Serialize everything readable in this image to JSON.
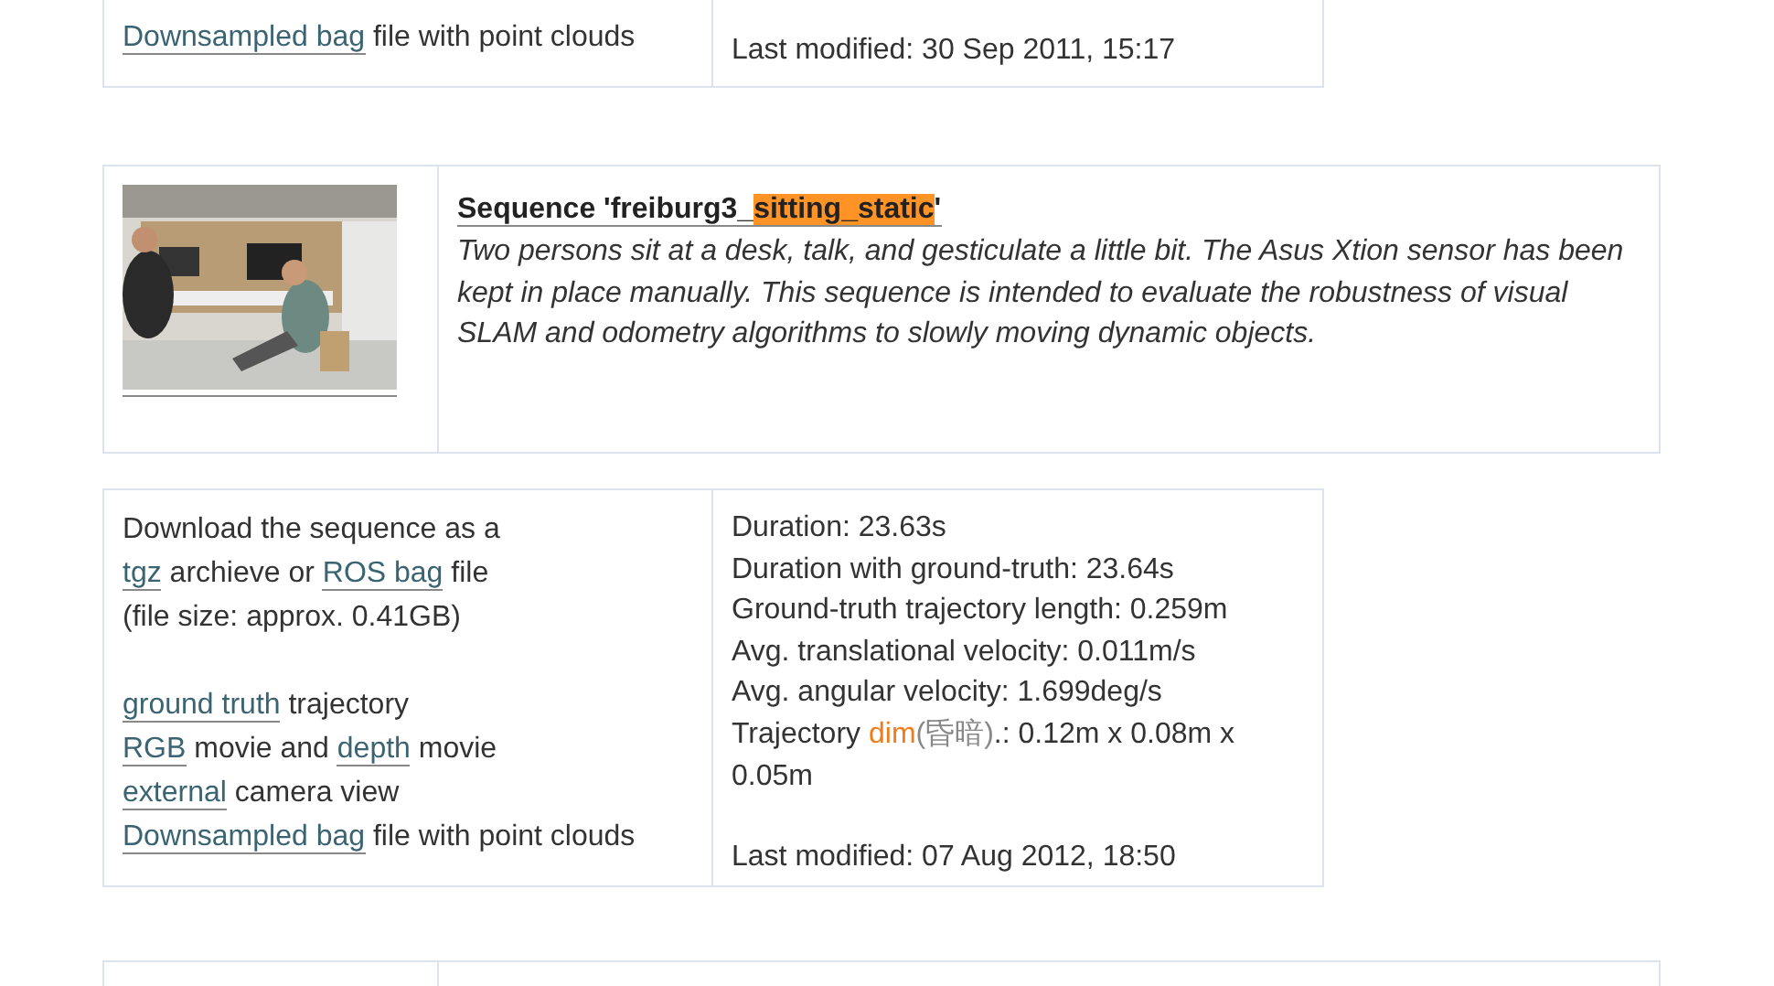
{
  "previous_entry": {
    "files": [
      [
        {
          "kind": "link",
          "text": "Downsampled bag"
        },
        {
          "kind": "text",
          "text": " file with point clouds"
        }
      ]
    ],
    "last_modified": "Last modified: 30 Sep 2011, 15:17"
  },
  "sequence": {
    "title": [
      {
        "kind": "text",
        "text": "Sequence 'freiburg3_"
      },
      {
        "kind": "highlight",
        "text": "sitting_static"
      },
      {
        "kind": "text",
        "text": "'"
      }
    ],
    "description": "Two persons sit at a desk, talk, and gesticulate a little bit. The Asus Xtion sensor has been kept in place manually. This sequence is intended to evaluate the robustness of visual SLAM and odometry algorithms to slowly moving dynamic objects."
  },
  "entry": {
    "download": [
      [
        {
          "kind": "text",
          "text": "Download the sequence as a"
        }
      ],
      [
        {
          "kind": "link",
          "text": "tgz"
        },
        {
          "kind": "text",
          "text": " archieve or "
        },
        {
          "kind": "link",
          "text": "ROS bag"
        },
        {
          "kind": "text",
          "text": " file"
        }
      ],
      [
        {
          "kind": "text",
          "text": "(file size: approx. 0.41GB)"
        }
      ]
    ],
    "files": [
      [
        {
          "kind": "link",
          "text": "ground truth"
        },
        {
          "kind": "text",
          "text": " trajectory"
        }
      ],
      [
        {
          "kind": "link",
          "text": "RGB"
        },
        {
          "kind": "text",
          "text": " movie and "
        },
        {
          "kind": "link",
          "text": "depth"
        },
        {
          "kind": "text",
          "text": " movie"
        }
      ],
      [
        {
          "kind": "link",
          "text": "external"
        },
        {
          "kind": "text",
          "text": " camera view"
        }
      ],
      [
        {
          "kind": "link",
          "text": "Downsampled bag"
        },
        {
          "kind": "text",
          "text": " file with point clouds"
        }
      ]
    ],
    "stats": [
      [
        {
          "kind": "text",
          "text": "Duration: 23.63s"
        }
      ],
      [
        {
          "kind": "text",
          "text": "Duration with ground-truth: 23.64s"
        }
      ],
      [
        {
          "kind": "text",
          "text": "Ground-truth trajectory length: 0.259m"
        }
      ],
      [
        {
          "kind": "text",
          "text": "Avg. translational velocity: 0.011m/s"
        }
      ],
      [
        {
          "kind": "text",
          "text": "Avg. angular velocity: 1.699deg/s"
        }
      ],
      [
        {
          "kind": "text",
          "text": "Trajectory "
        },
        {
          "kind": "term",
          "text": "dim"
        },
        {
          "kind": "translation",
          "text": "(昏暗)"
        },
        {
          "kind": "text",
          "text": ".: 0.12m x 0.08m x 0.05m"
        }
      ]
    ],
    "last_modified": "Last modified: 07 Aug 2012, 18:50"
  }
}
